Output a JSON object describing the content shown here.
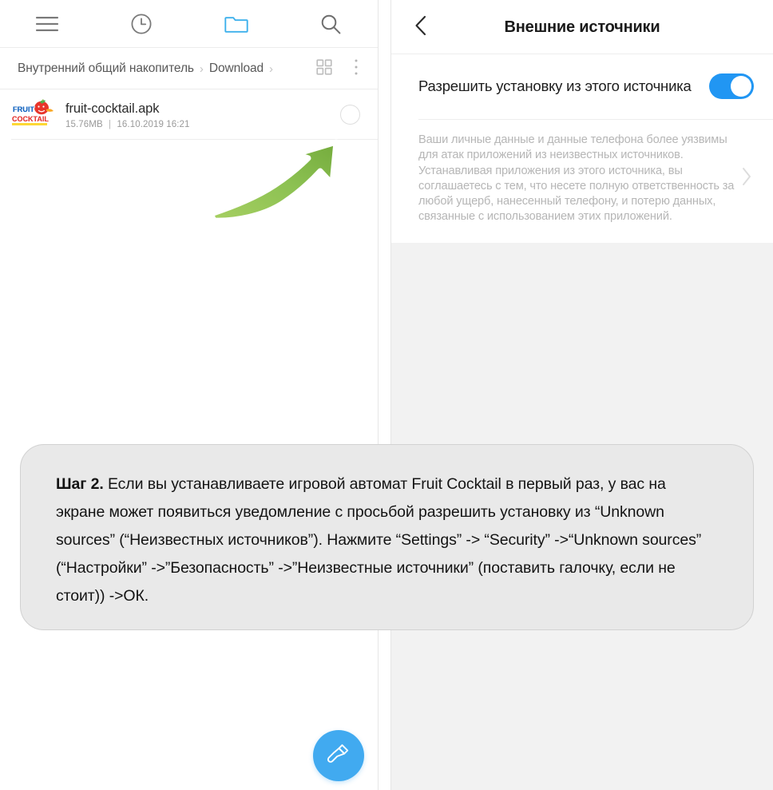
{
  "file_manager": {
    "toolbar": [
      {
        "name": "menu-icon",
        "label": "Меню"
      },
      {
        "name": "recent-icon",
        "label": "Недавние"
      },
      {
        "name": "folder-icon",
        "label": "Папки"
      },
      {
        "name": "search-icon",
        "label": "Поиск"
      }
    ],
    "breadcrumb": {
      "items": [
        "Внутренний общий накопитель",
        "Download"
      ],
      "separator": "›",
      "trailing_separator": "›"
    },
    "breadcrumb_tools": [
      {
        "name": "grid-view-icon",
        "label": "Вид сеткой"
      },
      {
        "name": "more-options-icon",
        "label": "Ещё"
      }
    ],
    "files": [
      {
        "icon_label": "fruit-cocktail-app-icon",
        "icon_text_top": "FRUIT",
        "icon_text_bottom": "COCKTAIL",
        "name": "fruit-cocktail.apk",
        "size": "15.76MB",
        "separator": "|",
        "date": "16.10.2019 16:21",
        "selected": false
      }
    ],
    "fab": {
      "name": "cleanup-brush-icon",
      "label": "Очистка"
    },
    "annotation_arrow": {
      "name": "green-arrow-annotation",
      "color": "#8cc152"
    }
  },
  "settings": {
    "header": {
      "back_label": "Назад",
      "title": "Внешние источники"
    },
    "toggle_row": {
      "label": "Разрешить установку из этого источника",
      "enabled": true,
      "accent_color": "#2196F3"
    },
    "description": {
      "text": "Ваши личные данные и данные телефона более уязвимы для атак приложений из неизвестных источников. Устанавливая приложения из этого источника, вы соглашаетесь с тем, что несете полную ответственность за любой ущерб, нанесенный телефону, и потерю данных, связанные с использованием этих приложений.",
      "chevron_label": "Подробнее"
    }
  },
  "caption": {
    "step_label": "Шаг 2.",
    "body": " Если вы устанавливаете игровой автомат Fruit Cocktail в первый раз, у вас на экране может появиться уведомление с просьбой разрешить установку из “Unknown sources” (“Неизвестных источников”). Нажмите “Settings” -> “Security” ->“Unknown sources” (“Настройки” ->”Безопасность” ->”Неизвестные источники” (поставить галочку, если не стоит)) ->ОК."
  }
}
